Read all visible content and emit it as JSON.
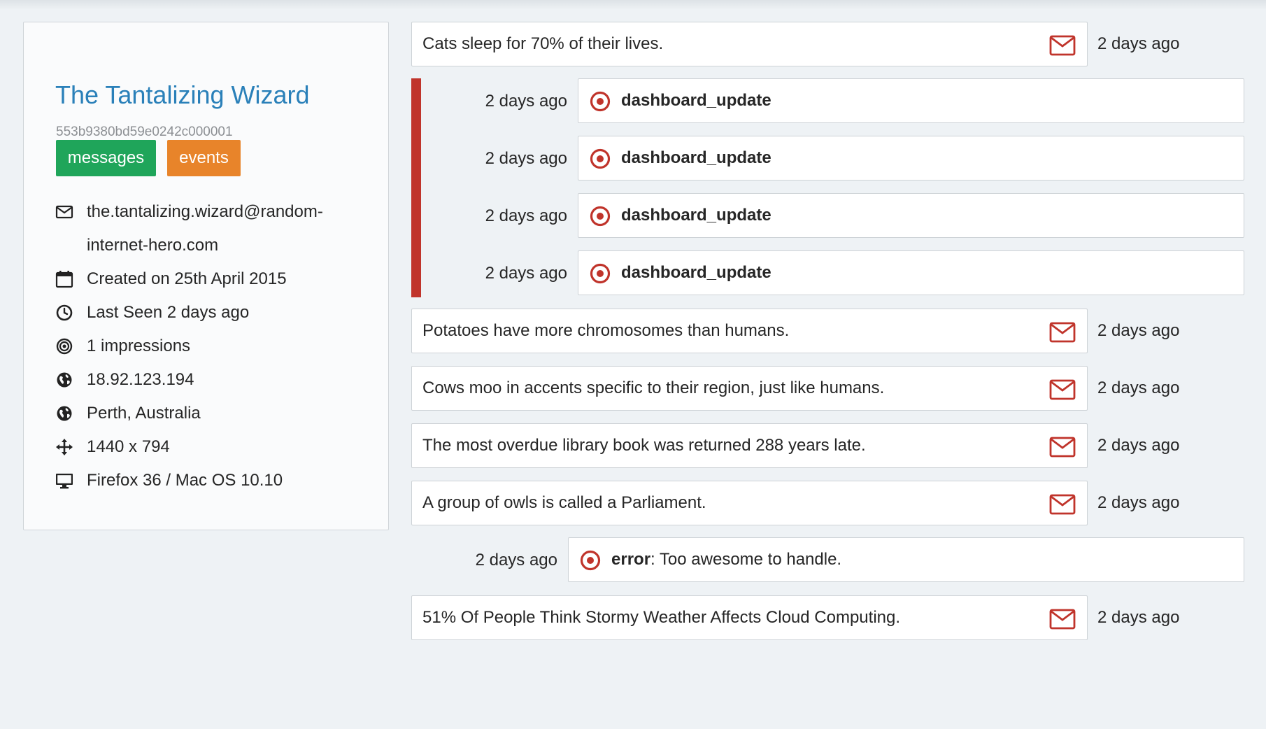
{
  "colors": {
    "accent_link": "#2a80b9",
    "messages_tag": "#1fa55a",
    "events_tag": "#e8842a",
    "event_red": "#c0342b",
    "page_bg": "#eef2f5"
  },
  "profile": {
    "name": "The Tantalizing Wizard",
    "id": "553b9380bd59e0242c000001",
    "tags": {
      "messages": "messages",
      "events": "events"
    },
    "email_line1": "the.tantalizing.wizard@random-",
    "email_line2": "internet-hero.com",
    "created": "Created on 25th April 2015",
    "last_seen": "Last Seen 2 days ago",
    "impressions": "1 impressions",
    "ip": "18.92.123.194",
    "location": "Perth, Australia",
    "resolution": "1440 x 794",
    "browser": "Firefox 36 / Mac OS 10.10",
    "icons": {
      "email": "envelope-icon",
      "created": "calendar-icon",
      "last_seen": "clock-icon",
      "impressions": "bullseye-icon",
      "ip": "globe-icon",
      "location": "globe-icon",
      "resolution": "move-arrows-icon",
      "browser": "monitor-icon"
    }
  },
  "feed": {
    "messages": [
      {
        "text": "Cats sleep for 70% of their lives.",
        "time": "2 days ago"
      },
      {
        "text": "Potatoes have more chromosomes than humans.",
        "time": "2 days ago"
      },
      {
        "text": "Cows moo in accents specific to their region, just like humans.",
        "time": "2 days ago"
      },
      {
        "text": "The most overdue library book was returned 288 years late.",
        "time": "2 days ago"
      },
      {
        "text": "A group of owls is called a Parliament.",
        "time": "2 days ago"
      },
      {
        "text": "51% Of People Think Stormy Weather Affects Cloud Computing.",
        "time": "2 days ago"
      }
    ],
    "event_group": [
      {
        "time": "2 days ago",
        "name": "dashboard_update"
      },
      {
        "time": "2 days ago",
        "name": "dashboard_update"
      },
      {
        "time": "2 days ago",
        "name": "dashboard_update"
      },
      {
        "time": "2 days ago",
        "name": "dashboard_update"
      }
    ],
    "error_event": {
      "time": "2 days ago",
      "name": "error",
      "detail": ": Too awesome to handle."
    }
  }
}
